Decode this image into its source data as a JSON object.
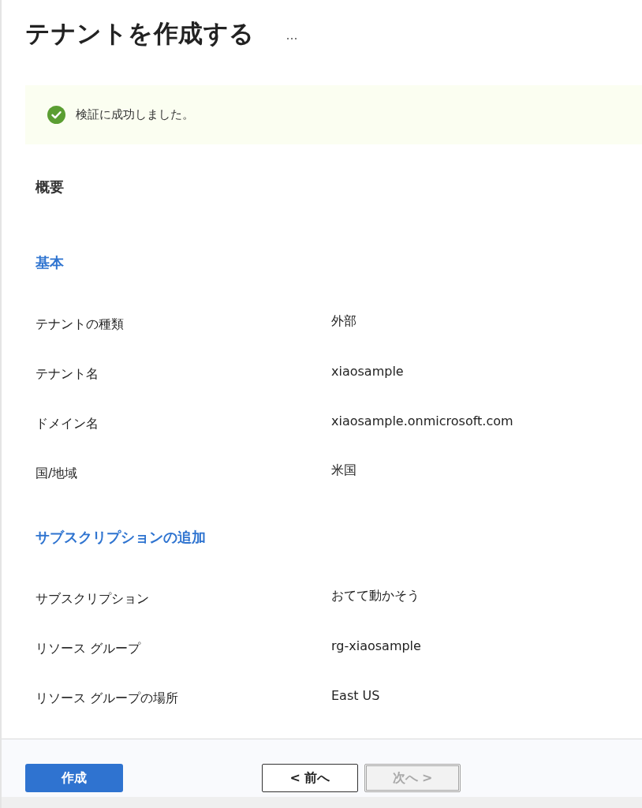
{
  "header": {
    "title": "テナントを作成する",
    "more": "…"
  },
  "banner": {
    "kind": "success",
    "message": "検証に成功しました。"
  },
  "summary": {
    "heading": "概要",
    "sections": [
      {
        "title": "基本",
        "rows": [
          {
            "label": "テナントの種類",
            "value": "外部"
          },
          {
            "label": "テナント名",
            "value": "xiaosample"
          },
          {
            "label": "ドメイン名",
            "value": "xiaosample.onmicrosoft.com"
          },
          {
            "label": "国/地域",
            "value": "米国"
          }
        ]
      },
      {
        "title": "サブスクリプションの追加",
        "rows": [
          {
            "label": "サブスクリプション",
            "value": "おてて動かそう"
          },
          {
            "label": "リソース グループ",
            "value": "rg-xiaosample"
          },
          {
            "label": "リソース グループの場所",
            "value": "East US"
          }
        ]
      }
    ]
  },
  "footer": {
    "buttons": [
      {
        "label": "作成",
        "kind": "primary",
        "disabled": false
      },
      {
        "label": "< 前へ",
        "kind": "secondary",
        "disabled": false
      },
      {
        "label": "次へ >",
        "kind": "secondary",
        "disabled": true
      }
    ]
  }
}
